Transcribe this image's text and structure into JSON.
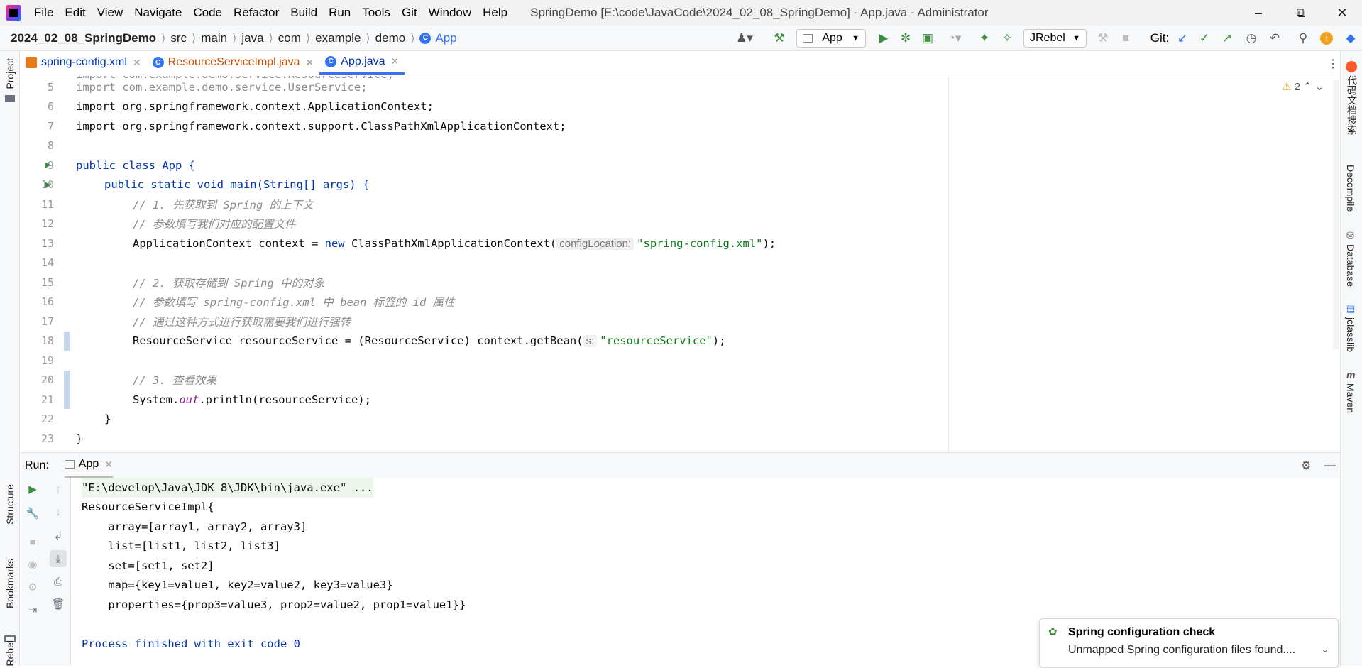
{
  "window": {
    "title": "SpringDemo [E:\\code\\JavaCode\\2024_02_08_SpringDemo] - App.java - Administrator",
    "menu": [
      "File",
      "Edit",
      "View",
      "Navigate",
      "Code",
      "Refactor",
      "Build",
      "Run",
      "Tools",
      "Git",
      "Window",
      "Help"
    ]
  },
  "breadcrumb": [
    "2024_02_08_SpringDemo",
    "src",
    "main",
    "java",
    "com",
    "example",
    "demo",
    "App"
  ],
  "toolbar": {
    "run_config": "App",
    "jrebel": "JRebel",
    "git_label": "Git:"
  },
  "tabs": [
    {
      "label": "spring-config.xml",
      "color": "#0033b3"
    },
    {
      "label": "ResourceServiceImpl.java",
      "color": "#c74c00"
    },
    {
      "label": "App.java",
      "color": "#0033b3"
    }
  ],
  "editor": {
    "warnings": "2",
    "lines": [
      {
        "n": "5",
        "text": "import com.example.demo.service.UserService;"
      },
      {
        "n": "6",
        "text": "import org.springframework.context.ApplicationContext;"
      },
      {
        "n": "7",
        "text": "import org.springframework.context.support.ClassPathXmlApplicationContext;"
      },
      {
        "n": "8",
        "text": ""
      },
      {
        "n": "9",
        "text": "public class App {"
      },
      {
        "n": "10",
        "text": "public static void main(String[] args) {"
      },
      {
        "n": "11",
        "text": "// 1. 先获取到 Spring 的上下文"
      },
      {
        "n": "12",
        "text": "// 参数填写我们对应的配置文件"
      },
      {
        "n": "13",
        "text": "ApplicationContext context = new ClassPathXmlApplicationContext( configLocation: \"spring-config.xml\");"
      },
      {
        "n": "14",
        "text": ""
      },
      {
        "n": "15",
        "text": "// 2. 获取存储到 Spring 中的对象"
      },
      {
        "n": "16",
        "text": "// 参数填写 spring-config.xml 中 bean 标签的 id 属性"
      },
      {
        "n": "17",
        "text": "// 通过这种方式进行获取需要我们进行强转"
      },
      {
        "n": "18",
        "text": "ResourceService resourceService = (ResourceService) context.getBean( s: \"resourceService\");"
      },
      {
        "n": "19",
        "text": ""
      },
      {
        "n": "20",
        "text": "// 3. 查看效果"
      },
      {
        "n": "21",
        "text": "System.out.println(resourceService);"
      },
      {
        "n": "22",
        "text": "}"
      },
      {
        "n": "23",
        "text": "}"
      }
    ],
    "l13": {
      "a": "ApplicationContext context = ",
      "kw": "new",
      "b": " ClassPathXmlApplicationContext(",
      "hint": "configLocation:",
      "str": "\"spring-config.xml\"",
      "end": ");"
    },
    "l18": {
      "a": "ResourceService resourceService = (ResourceService) context.getBean(",
      "hint": "s:",
      "str": "\"resourceService\"",
      "end": ");"
    },
    "l21": {
      "a": "System.",
      "it": "out",
      "b": ".println(resourceService);"
    }
  },
  "run": {
    "label": "Run:",
    "tab": "App",
    "console": [
      "\"E:\\develop\\Java\\JDK 8\\JDK\\bin\\java.exe\" ...",
      "ResourceServiceImpl{",
      "    array=[array1, array2, array3]",
      "    list=[list1, list2, list3]",
      "    set=[set1, set2]",
      "    map={key1=value1, key2=value2, key3=value3}",
      "    properties={prop3=value3, prop2=value2, prop1=value1}}",
      "",
      "Process finished with exit code 0"
    ]
  },
  "left_panels": [
    "Project",
    "Structure",
    "Bookmarks",
    "Rebel"
  ],
  "right_panels": [
    "代码文档搜索",
    "Decompile",
    "Database",
    "jclasslib",
    "Maven"
  ],
  "notification": {
    "title": "Spring configuration check",
    "body": "Unmapped Spring configuration files found...."
  }
}
